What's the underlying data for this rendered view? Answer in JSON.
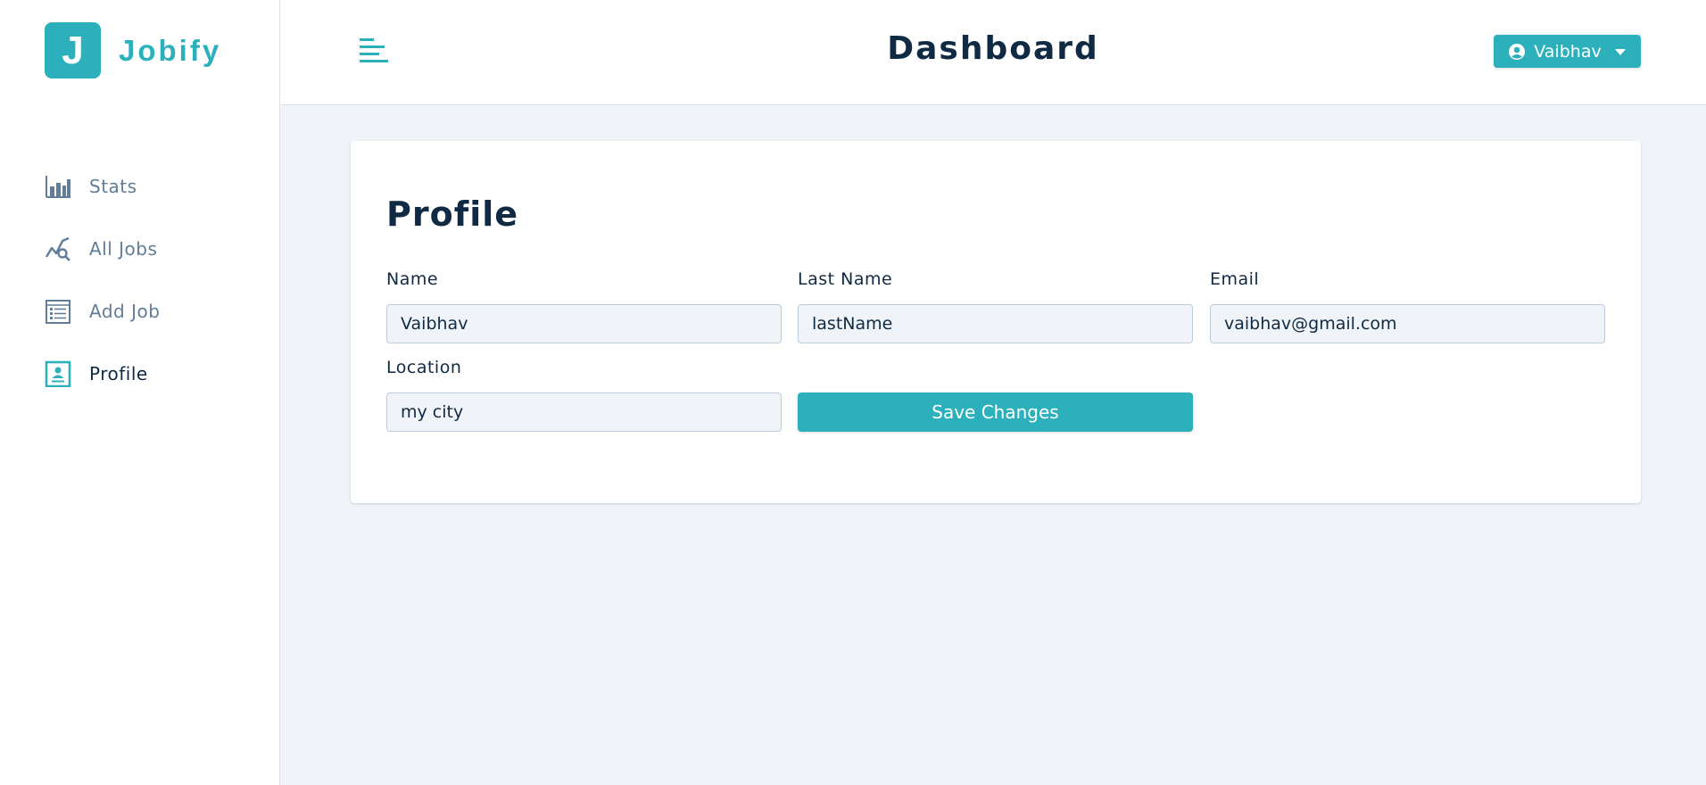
{
  "brand": {
    "letter": "J",
    "name": "Jobify",
    "color": "#2cb1bc"
  },
  "header": {
    "title": "Dashboard",
    "user_name": "Vaibhav"
  },
  "sidebar": {
    "items": [
      {
        "label": "Stats",
        "icon": "bar-chart-icon",
        "active": false
      },
      {
        "label": "All Jobs",
        "icon": "trend-search-icon",
        "active": false
      },
      {
        "label": "Add Job",
        "icon": "form-icon",
        "active": false
      },
      {
        "label": "Profile",
        "icon": "profile-card-icon",
        "active": true
      }
    ]
  },
  "profile": {
    "title": "Profile",
    "fields": {
      "name": {
        "label": "Name",
        "value": "Vaibhav"
      },
      "last_name": {
        "label": "Last Name",
        "value": "lastName"
      },
      "email": {
        "label": "Email",
        "value": "vaibhav@gmail.com"
      },
      "location": {
        "label": "Location",
        "value": "my city"
      }
    },
    "save_label": "Save Changes"
  },
  "colors": {
    "primary": "#2cb1bc",
    "background": "#f0f4f8",
    "text": "#102a43",
    "muted": "#627d98"
  }
}
